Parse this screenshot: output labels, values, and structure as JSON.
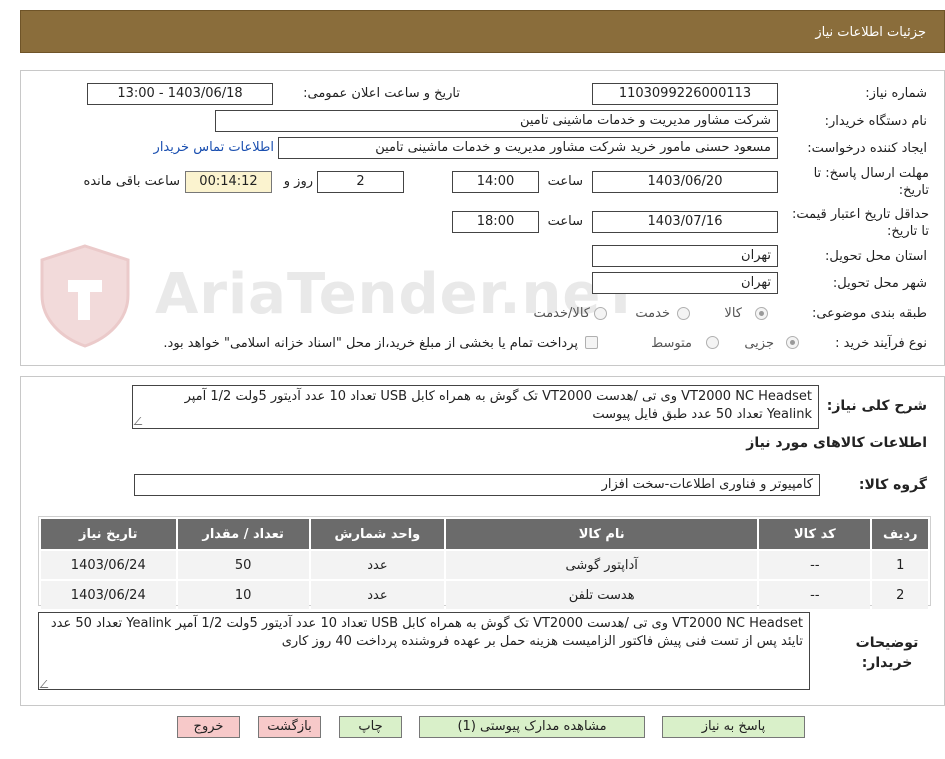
{
  "header": {
    "title": "جزئیات اطلاعات نیاز"
  },
  "watermark": {
    "text": "AriaTender.neT"
  },
  "form": {
    "need_number": {
      "label": "شماره نیاز:",
      "value": "1103099226000113"
    },
    "announce_datetime": {
      "label": "تاریخ و ساعت اعلان عمومی:",
      "value": "1403/06/18 - 13:00"
    },
    "buyer_org": {
      "label": "نام دستگاه خریدار:",
      "value": "شرکت مشاور مدیریت و خدمات ماشینی تامین"
    },
    "requester": {
      "label": "ایجاد کننده درخواست:",
      "value": "مسعود حسنی مامور خرید شرکت مشاور مدیریت و خدمات ماشینی تامین",
      "contact_link": "اطلاعات تماس خریدار"
    },
    "response_deadline": {
      "label": "مهلت ارسال پاسخ: تا تاریخ:",
      "date": "1403/06/20",
      "time_label": "ساعت",
      "time": "14:00",
      "days": "2",
      "days_label": "روز و",
      "remaining": "00:14:12",
      "remaining_label": "ساعت باقی مانده"
    },
    "price_validity": {
      "label": "حداقل تاریخ اعتبار قیمت: تا تاریخ:",
      "date": "1403/07/16",
      "time_label": "ساعت",
      "time": "18:00"
    },
    "province": {
      "label": "استان محل تحویل:",
      "value": "تهران"
    },
    "city": {
      "label": "شهر محل تحویل:",
      "value": "تهران"
    },
    "category": {
      "label": "طبقه بندی موضوعی:",
      "options": [
        "کالا",
        "خدمت",
        "کالا/خدمت"
      ],
      "selected": "کالا"
    },
    "purchase_type": {
      "label": "نوع فرآیند خرید :",
      "options": [
        "جزیی",
        "متوسط"
      ],
      "selected": "جزیی",
      "note": "پرداخت تمام یا بخشی از مبلغ خرید،از محل \"اسناد خزانه اسلامی\" خواهد بود."
    }
  },
  "summary": {
    "label": "شرح کلی نیاز:",
    "text": "VT2000 NC Headset وی تی /هدست VT2000 تک گوش به همراه کابل USB تعداد 10 عدد  آدیتور 5ولت 1/2 آمپر Yealink  تعداد 50 عدد    طبق فایل پیوست"
  },
  "goods_section_title": "اطلاعات کالاهای مورد نیاز",
  "goods_group": {
    "label": "گروه کالا:",
    "value": "کامپیوتر و فناوری اطلاعات-سخت افزار"
  },
  "items_table": {
    "headers": [
      "ردیف",
      "کد کالا",
      "نام کالا",
      "واحد شمارش",
      "تعداد / مقدار",
      "تاریخ نیاز"
    ],
    "rows": [
      [
        "1",
        "--",
        "آداپتور گوشی",
        "عدد",
        "50",
        "1403/06/24"
      ],
      [
        "2",
        "--",
        "هدست تلفن",
        "عدد",
        "10",
        "1403/06/24"
      ]
    ]
  },
  "buyer_notes": {
    "label": "توضیحات خریدار:",
    "text": "VT2000 NC Headset وی تی /هدست VT2000 تک گوش به همراه کابل USB تعداد 10 عدد  آدیتور 5ولت 1/2 آمپر Yealink  تعداد 50 عدد   تایئد پس از تست فنی  پیش فاکتور الزامیست هزینه حمل بر عهده فروشنده پرداخت 40 روز  کاری"
  },
  "buttons": {
    "respond": "پاسخ به نیاز",
    "attachments": "مشاهده مدارک پیوستی (1)",
    "print": "چاپ",
    "back": "بازگشت",
    "exit": "خروج"
  }
}
